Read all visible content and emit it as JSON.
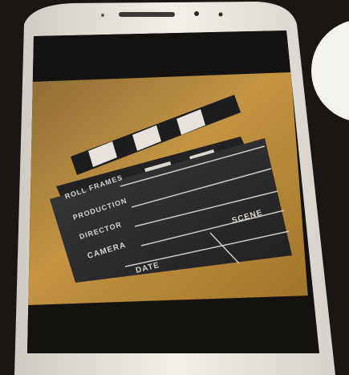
{
  "photo": {
    "subject": "smartphone displaying a film clapperboard"
  },
  "clapperboard": {
    "roll_frames": "ROLL FRAMES",
    "production": "PRODUCTION",
    "director": "DIRECTOR",
    "camera": "CAMERA",
    "scene": "SCENE",
    "date": "DATE"
  },
  "colors": {
    "background": "#1a1614",
    "phone_body": "#ece8e2",
    "screen_wood": "#b88a3e",
    "slate": "#2b2b2d"
  }
}
